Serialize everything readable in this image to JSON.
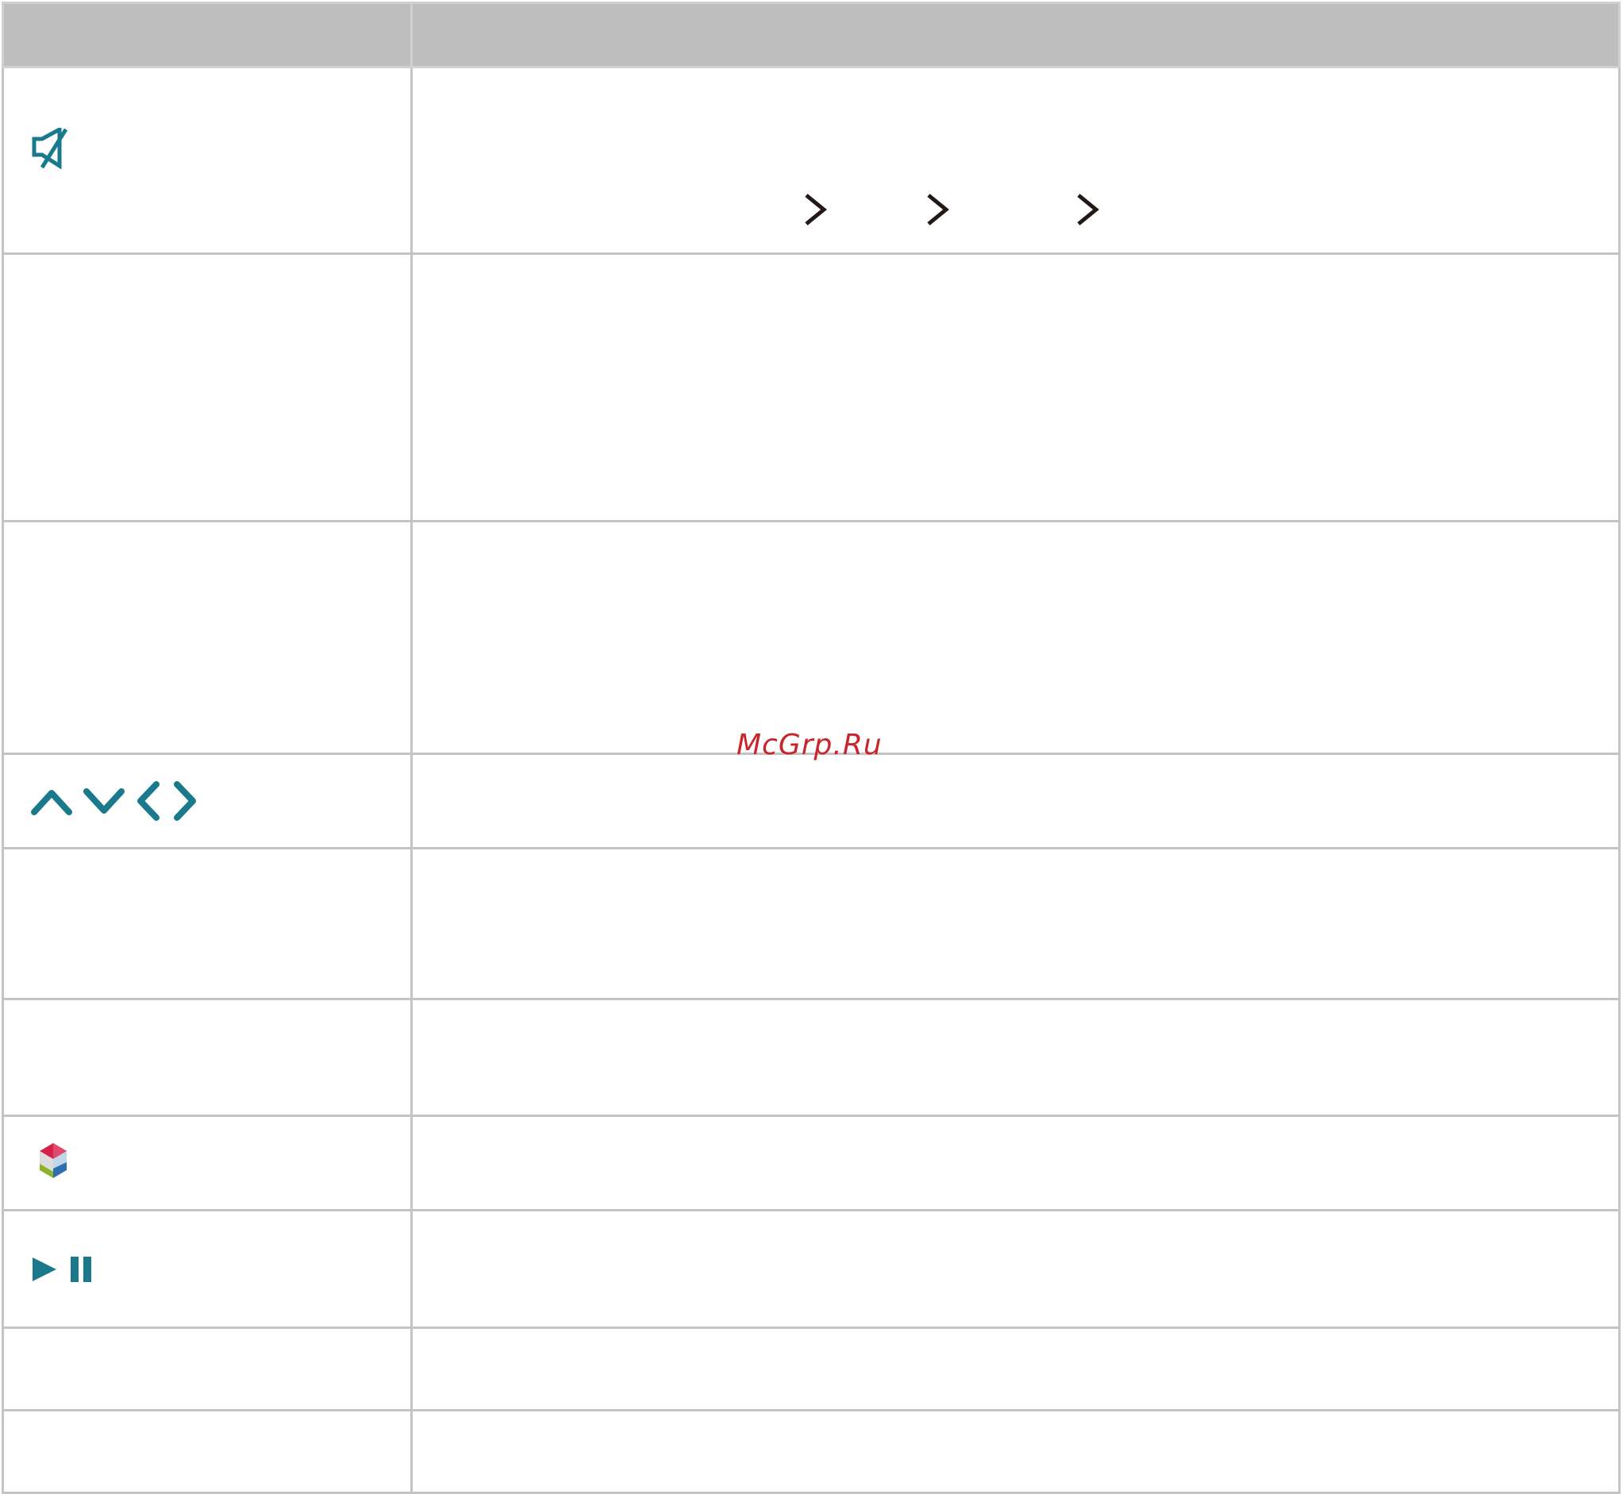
{
  "table": {
    "header": [
      "",
      ""
    ],
    "rows": [
      {
        "icon": "mute-icon",
        "description": ""
      },
      {
        "icon": "",
        "description": ""
      },
      {
        "icon": "",
        "description": ""
      },
      {
        "icon": "direction-arrows-icon",
        "description": ""
      },
      {
        "icon": "",
        "description": ""
      },
      {
        "icon": "",
        "description": ""
      },
      {
        "icon": "smart-hub-icon",
        "description": ""
      },
      {
        "icon": "play-pause-icon",
        "description": ""
      },
      {
        "icon": "",
        "description": ""
      },
      {
        "icon": "",
        "description": ""
      }
    ],
    "menu_path_separators": [
      "chevron-right-icon",
      "chevron-right-icon",
      "chevron-right-icon"
    ]
  },
  "colors": {
    "icon_teal": "#1a7a8c",
    "header_bg": "#bebebe",
    "grid_line": "#c4c4c4",
    "watermark": "#c8262b"
  },
  "watermark": "McGrp.Ru"
}
